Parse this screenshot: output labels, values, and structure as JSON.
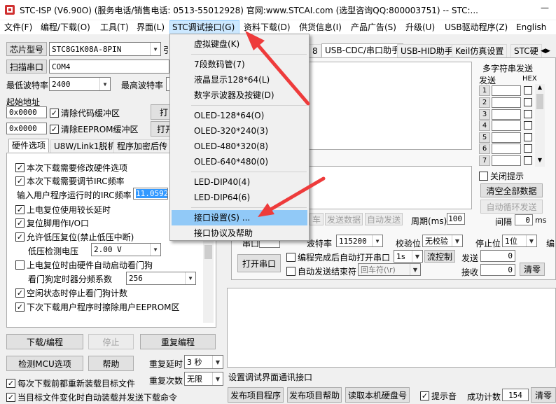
{
  "title": "STC-ISP (V6.90O) (服务电话/销售电话: 0513-55012928) 官网:www.STCAI.com (选型咨询QQ:800003751) -- STC:...",
  "window_controls": {
    "minimize": "—"
  },
  "menubar": [
    "文件(F)",
    "编程/下载(O)",
    "工具(T)",
    "界面(L)",
    "STC调试接口(G)",
    "资料下载(D)",
    "供货信息(I)",
    "产品广告(S)",
    "升级(U)",
    "USB驱动程序(Z)",
    "English"
  ],
  "left": {
    "chip_label": "芯片型号",
    "chip_value": "STC8G1K08A-8PIN",
    "chip_trunc": "引",
    "scan_button": "扫描串口",
    "port_value": "COM4",
    "min_baud_label": "最低波特率",
    "min_baud_value": "2400",
    "max_baud_label": "最高波特率",
    "start_addr_label": "起始地址",
    "addr1": "0x0000",
    "clear_code": "清除代码缓冲区",
    "open_trunc1": "打",
    "addr2": "0x0000",
    "clear_eeprom": "清除EEPROM缓冲区",
    "open_trunc2": "打开",
    "tabs": [
      "硬件选项",
      "U8W/Link1脱机",
      "程序加密后传"
    ],
    "options": {
      "o1": "本次下载需要修改硬件选项",
      "o2": "本次下载需要调节IRC频率",
      "irc_label": "输入用户程序运行时的IRC频率",
      "irc_value": "11.0592",
      "o3": "上电复位使用较长延时",
      "o4": "复位脚用作I/O口",
      "o5": "允许低压复位(禁止低压中断)",
      "lv_label": "低压检测电压",
      "lv_value": "2.00 V",
      "o6": "上电复位时由硬件自动启动看门狗",
      "wdt_label": "看门狗定时器分频系数",
      "wdt_value": "256",
      "o7": "空闲状态时停止看门狗计数",
      "o8": "下次下载用户程序时擦除用户EEPROM区"
    },
    "download_button": "下载/编程",
    "stop_button": "停止",
    "reprogram_button": "重复编程",
    "check_mcu_button": "检测MCU选项",
    "help_button": "帮助",
    "repeat_delay_label": "重复延时",
    "repeat_delay_value": "3 秒",
    "repeat_count_label": "重复次数",
    "repeat_count_value": "无限",
    "reload_before": "每次下载前都重新装载目标文件",
    "auto_reload": "当目标文件变化时自动装载并发送下载命令"
  },
  "right": {
    "tab_trunc": "8",
    "tabs": [
      "USB-CDC/串口助手",
      "USB-HID助手",
      "Keil仿真设置",
      "STC硬"
    ],
    "multi_title": "多字符串发送",
    "send_col": "发送",
    "hex_col": "HEX",
    "rows": [
      "1",
      "2",
      "3",
      "4",
      "5",
      "6",
      "7"
    ],
    "close_tip": "关闭提示",
    "clear_all": "清空全部数据",
    "auto_loop": "自动循环发送",
    "interval_label": "间隔",
    "interval_value": "0",
    "interval_unit": "ms",
    "send_btn_trunc": "车",
    "send_data": "发送数据",
    "auto_send": "自动发送",
    "period_label": "周期(ms)",
    "period_value": "100",
    "serial_trunc": "串口",
    "baud_label": "波特率",
    "baud_value": "115200",
    "parity_label": "校验位",
    "parity_value": "无校验",
    "stop_label": "停止位",
    "stop_value": "1位",
    "trunc_right": "编",
    "open_port": "打开串口",
    "auto_open": "编程完成后自动打开串口",
    "auto_open_value": "1s",
    "flow_control": "流控制",
    "send_label": "发送",
    "send_count": "0",
    "auto_end": "自动发送结束符",
    "end_value": "回车符(\\r)",
    "recv_label": "接收",
    "recv_count": "0",
    "clear_btn": "清零",
    "status_text": "设置调试界面通讯接口",
    "publish_project": "发布项目程序",
    "publish_help": "发布项目帮助",
    "read_disk": "读取本机硬盘号",
    "beep_label": "提示音",
    "success_label": "成功计数",
    "success_value": "154",
    "clear_success": "清零"
  },
  "dropdown": {
    "items": [
      {
        "label": "虚拟键盘(K)",
        "highlight": false
      },
      {
        "label": "7段数码管(7)",
        "highlight": false
      },
      {
        "label": "液晶显示128*64(L)",
        "highlight": false
      },
      {
        "label": "数字示波器及按键(D)",
        "highlight": false
      },
      {
        "label": "OLED-128*64(O)",
        "highlight": false
      },
      {
        "label": "OLED-320*240(3)",
        "highlight": false
      },
      {
        "label": "OLED-480*320(8)",
        "highlight": false
      },
      {
        "label": "OLED-640*480(0)",
        "highlight": false
      },
      {
        "label": "LED-DIP40(4)",
        "highlight": false
      },
      {
        "label": "LED-DIP64(6)",
        "highlight": false
      },
      {
        "label": "接口设置(S) ...",
        "highlight": true
      },
      {
        "label": "接口协议及帮助",
        "highlight": false
      }
    ]
  },
  "colors": {
    "arrow": "#ee3b3b",
    "highlight": "#91c9f7",
    "menu_active": "#cce8ff"
  }
}
